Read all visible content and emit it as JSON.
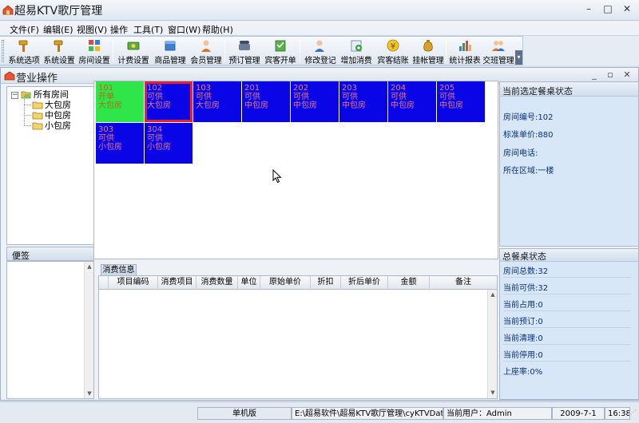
{
  "window": {
    "title": "超易KTV歌厅管理"
  },
  "menu": [
    "文件(F)",
    "编辑(E)",
    "视图(V)",
    "操作",
    "工具(T)",
    "窗口(W)",
    "帮助(H)"
  ],
  "toolbar": {
    "buttons": [
      "系统选项",
      "系统设置",
      "房间设置",
      "计费设置",
      "商品管理",
      "会员管理",
      "预订管理",
      "宾客开单",
      "修改登记",
      "增加消费",
      "宾客结账",
      "挂帐管理",
      "统计报表",
      "交班管理"
    ]
  },
  "child_window": {
    "title": "营业操作"
  },
  "tree": {
    "root": "所有房间",
    "children": [
      "大包房",
      "中包房",
      "小包房"
    ]
  },
  "memo": {
    "title": "便签"
  },
  "rooms": [
    {
      "number": "101",
      "status": "开单",
      "type": "大包房",
      "state": "occupied"
    },
    {
      "number": "102",
      "status": "可供",
      "type": "大包房",
      "state": "selected"
    },
    {
      "number": "103",
      "status": "可供",
      "type": "大包房",
      "state": "available"
    },
    {
      "number": "201",
      "status": "可供",
      "type": "中包房",
      "state": "available"
    },
    {
      "number": "202",
      "status": "可供",
      "type": "中包房",
      "state": "available"
    },
    {
      "number": "203",
      "status": "可供",
      "type": "中包房",
      "state": "available"
    },
    {
      "number": "204",
      "status": "可供",
      "type": "中包房",
      "state": "available"
    },
    {
      "number": "205",
      "status": "可供",
      "type": "中包房",
      "state": "available"
    },
    {
      "number": "303",
      "status": "可供",
      "type": "小包房",
      "state": "available"
    },
    {
      "number": "304",
      "status": "可供",
      "type": "小包房",
      "state": "available"
    }
  ],
  "consumption": {
    "tab": "消费信息",
    "columns": [
      "项目编码",
      "消费项目",
      "消费数量",
      "单位",
      "原始单价",
      "折扣",
      "折后单价",
      "金额",
      "备注"
    ],
    "rows": []
  },
  "current_status": {
    "title": "当前选定餐桌状态",
    "room_number": "房间编号:102",
    "price": "标准单价:880",
    "phone": "房间电话:",
    "area": "所在区域:一楼"
  },
  "summary": {
    "title": "总餐桌状态",
    "total": "房间总数:32",
    "available": "当前可供:32",
    "occupied": "当前占用:0",
    "reserved": "当前预订:0",
    "cleaning": "当前清理:0",
    "disabled": "当前停用:0",
    "occupancy": "上座率:0%"
  },
  "statusbar": {
    "mode": "单机版",
    "path": "E:\\超易软件\\超易KTV歌厅管理\\cyKTVData.sys",
    "user": "当前用户：Admin",
    "date": "2009-7-1",
    "time": "16:38"
  },
  "colors": {
    "room_available": "#0a05e6",
    "room_occupied": "#2ee64a",
    "room_selected_border": "#e8202b",
    "room_text": "#e77a8e",
    "info_text": "#0a2f7a"
  }
}
